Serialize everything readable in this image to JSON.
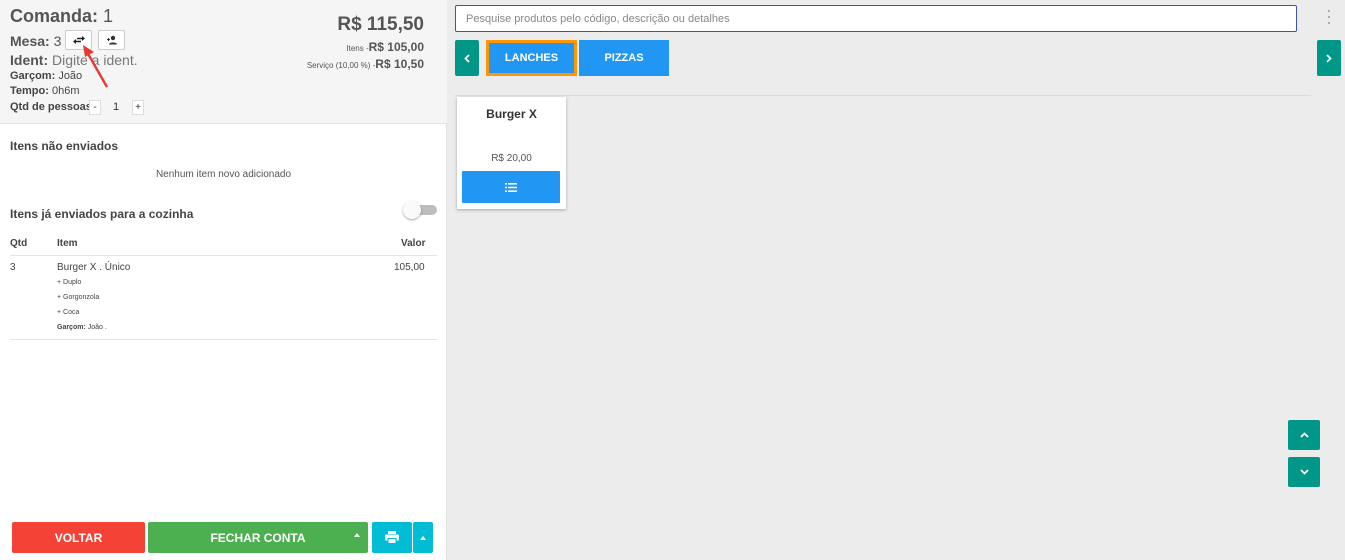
{
  "header": {
    "comanda_label": "Comanda:",
    "comanda_number": "1",
    "mesa_label": "Mesa:",
    "mesa_number": "3",
    "ident_label": "Ident:",
    "ident_placeholder": "Digite a ident.",
    "garcom_label": "Garçom:",
    "garcom_value": "João",
    "tempo_label": "Tempo:",
    "tempo_value": "0h6m",
    "qtd_pessoas_label": "Qtd de pessoas:",
    "qtd_pessoas_value": "1",
    "qty_minus": "-",
    "qty_plus": "+",
    "total": "R$ 115,50",
    "item_label": "Itens -",
    "item_value": "R$ 105,00",
    "servico_label": "Serviço (10,00 %) -",
    "servico_value": "R$ 10,50"
  },
  "sections": {
    "not_sent_title": "Itens não enviados",
    "not_sent_empty": "Nenhum item novo adicionado",
    "sent_title": "Itens já enviados para a cozinha"
  },
  "table": {
    "col_qtd": "Qtd",
    "col_item": "Item",
    "col_valor": "Valor",
    "rows": [
      {
        "qtd": "3",
        "item": "Burger X . Único",
        "valor": "105,00",
        "modifiers": [
          "+ Duplo",
          "+ Gorgonzola",
          "+ Coca"
        ],
        "garcom_label": "Garçom:",
        "garcom_value": "João ."
      }
    ]
  },
  "footer": {
    "voltar": "VOLTAR",
    "fechar_conta": "FECHAR CONTA"
  },
  "search": {
    "placeholder": "Pesquise produtos pelo código, descrição ou detalhes"
  },
  "categories": [
    {
      "label": "LANCHES",
      "selected": true
    },
    {
      "label": "PIZZAS",
      "selected": false
    }
  ],
  "products": [
    {
      "name": "Burger X",
      "price": "R$ 20,00"
    }
  ],
  "colors": {
    "red": "#f44336",
    "green": "#4caf50",
    "cyan": "#00bcd4",
    "blue": "#2196f3",
    "teal": "#009688",
    "orange_highlight": "#ff9800",
    "annotation_arrow": "#e53935"
  },
  "icons": {
    "swap": "swap-horiz-icon",
    "person": "person-add-icon",
    "print": "print-icon",
    "list": "list-icon",
    "more": "more-vert-icon",
    "prev": "chevron-left-icon",
    "next": "chevron-right-icon",
    "up": "chevron-up-icon",
    "down": "chevron-down-icon"
  }
}
